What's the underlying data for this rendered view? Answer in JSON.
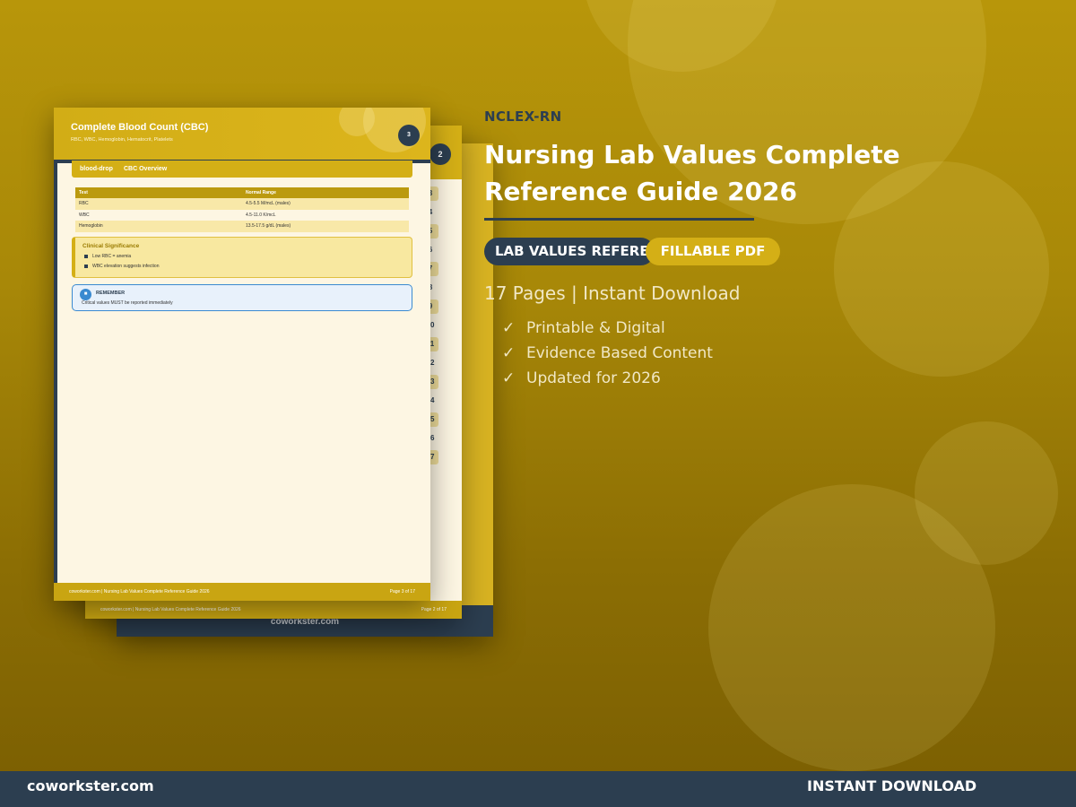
{
  "brand_colors": {
    "gold": "#d4af16",
    "navy": "#2c3e50",
    "background": "#a88808"
  },
  "mockup": {
    "back_page": {
      "footer_site": "coworkster.com"
    },
    "middle_page": {
      "page_badge": "2",
      "toc_numbers": [
        "3",
        "4",
        "5",
        "6",
        "7",
        "8",
        "9",
        "10",
        "11",
        "12",
        "13",
        "14",
        "15",
        "16",
        "17"
      ],
      "footer_left": "coworkster.com  |  Nursing Lab Values Complete Reference Guide 2026",
      "footer_right": "Page 2 of 17"
    },
    "front_page": {
      "title": "Complete Blood Count (CBC)",
      "subtitle": "RBC, WBC, Hemoglobin, Hematocrit, Platelets",
      "page_badge": "3",
      "section_icon_label": "blood-drop",
      "section_title": "CBC Overview",
      "table": {
        "headers": [
          "Test",
          "Normal Range"
        ],
        "rows": [
          [
            "RBC",
            "4.5-5.5 M/mcL (males)"
          ],
          [
            "WBC",
            "4.5-11.0 K/mcL"
          ],
          [
            "Hemoglobin",
            "13.5-17.5 g/dL (males)"
          ]
        ]
      },
      "clinical": {
        "title": "Clinical Significance",
        "items": [
          "Low RBC = anemia",
          "WBC elevation suggests infection"
        ]
      },
      "remember": {
        "icon": "■",
        "title": "REMEMBER",
        "text": "Critical values MUST be reported immediately"
      },
      "footer_left": "coworkster.com  |  Nursing Lab Values Complete Reference Guide 2026",
      "footer_right": "Page 3 of 17"
    }
  },
  "product": {
    "eyebrow": "NCLEX-RN",
    "title_line1": "Nursing Lab Values Complete",
    "title_line2": "Reference Guide 2026",
    "tag_primary": "LAB VALUES REFERENCE",
    "tag_secondary": "FILLABLE PDF",
    "pages_line": "17 Pages | Instant Download",
    "check_glyph": "✓",
    "features": [
      "Printable & Digital",
      "Evidence Based Content",
      "Updated for 2026"
    ]
  },
  "bottom_bar": {
    "site": "coworkster.com",
    "cta": "INSTANT DOWNLOAD"
  }
}
